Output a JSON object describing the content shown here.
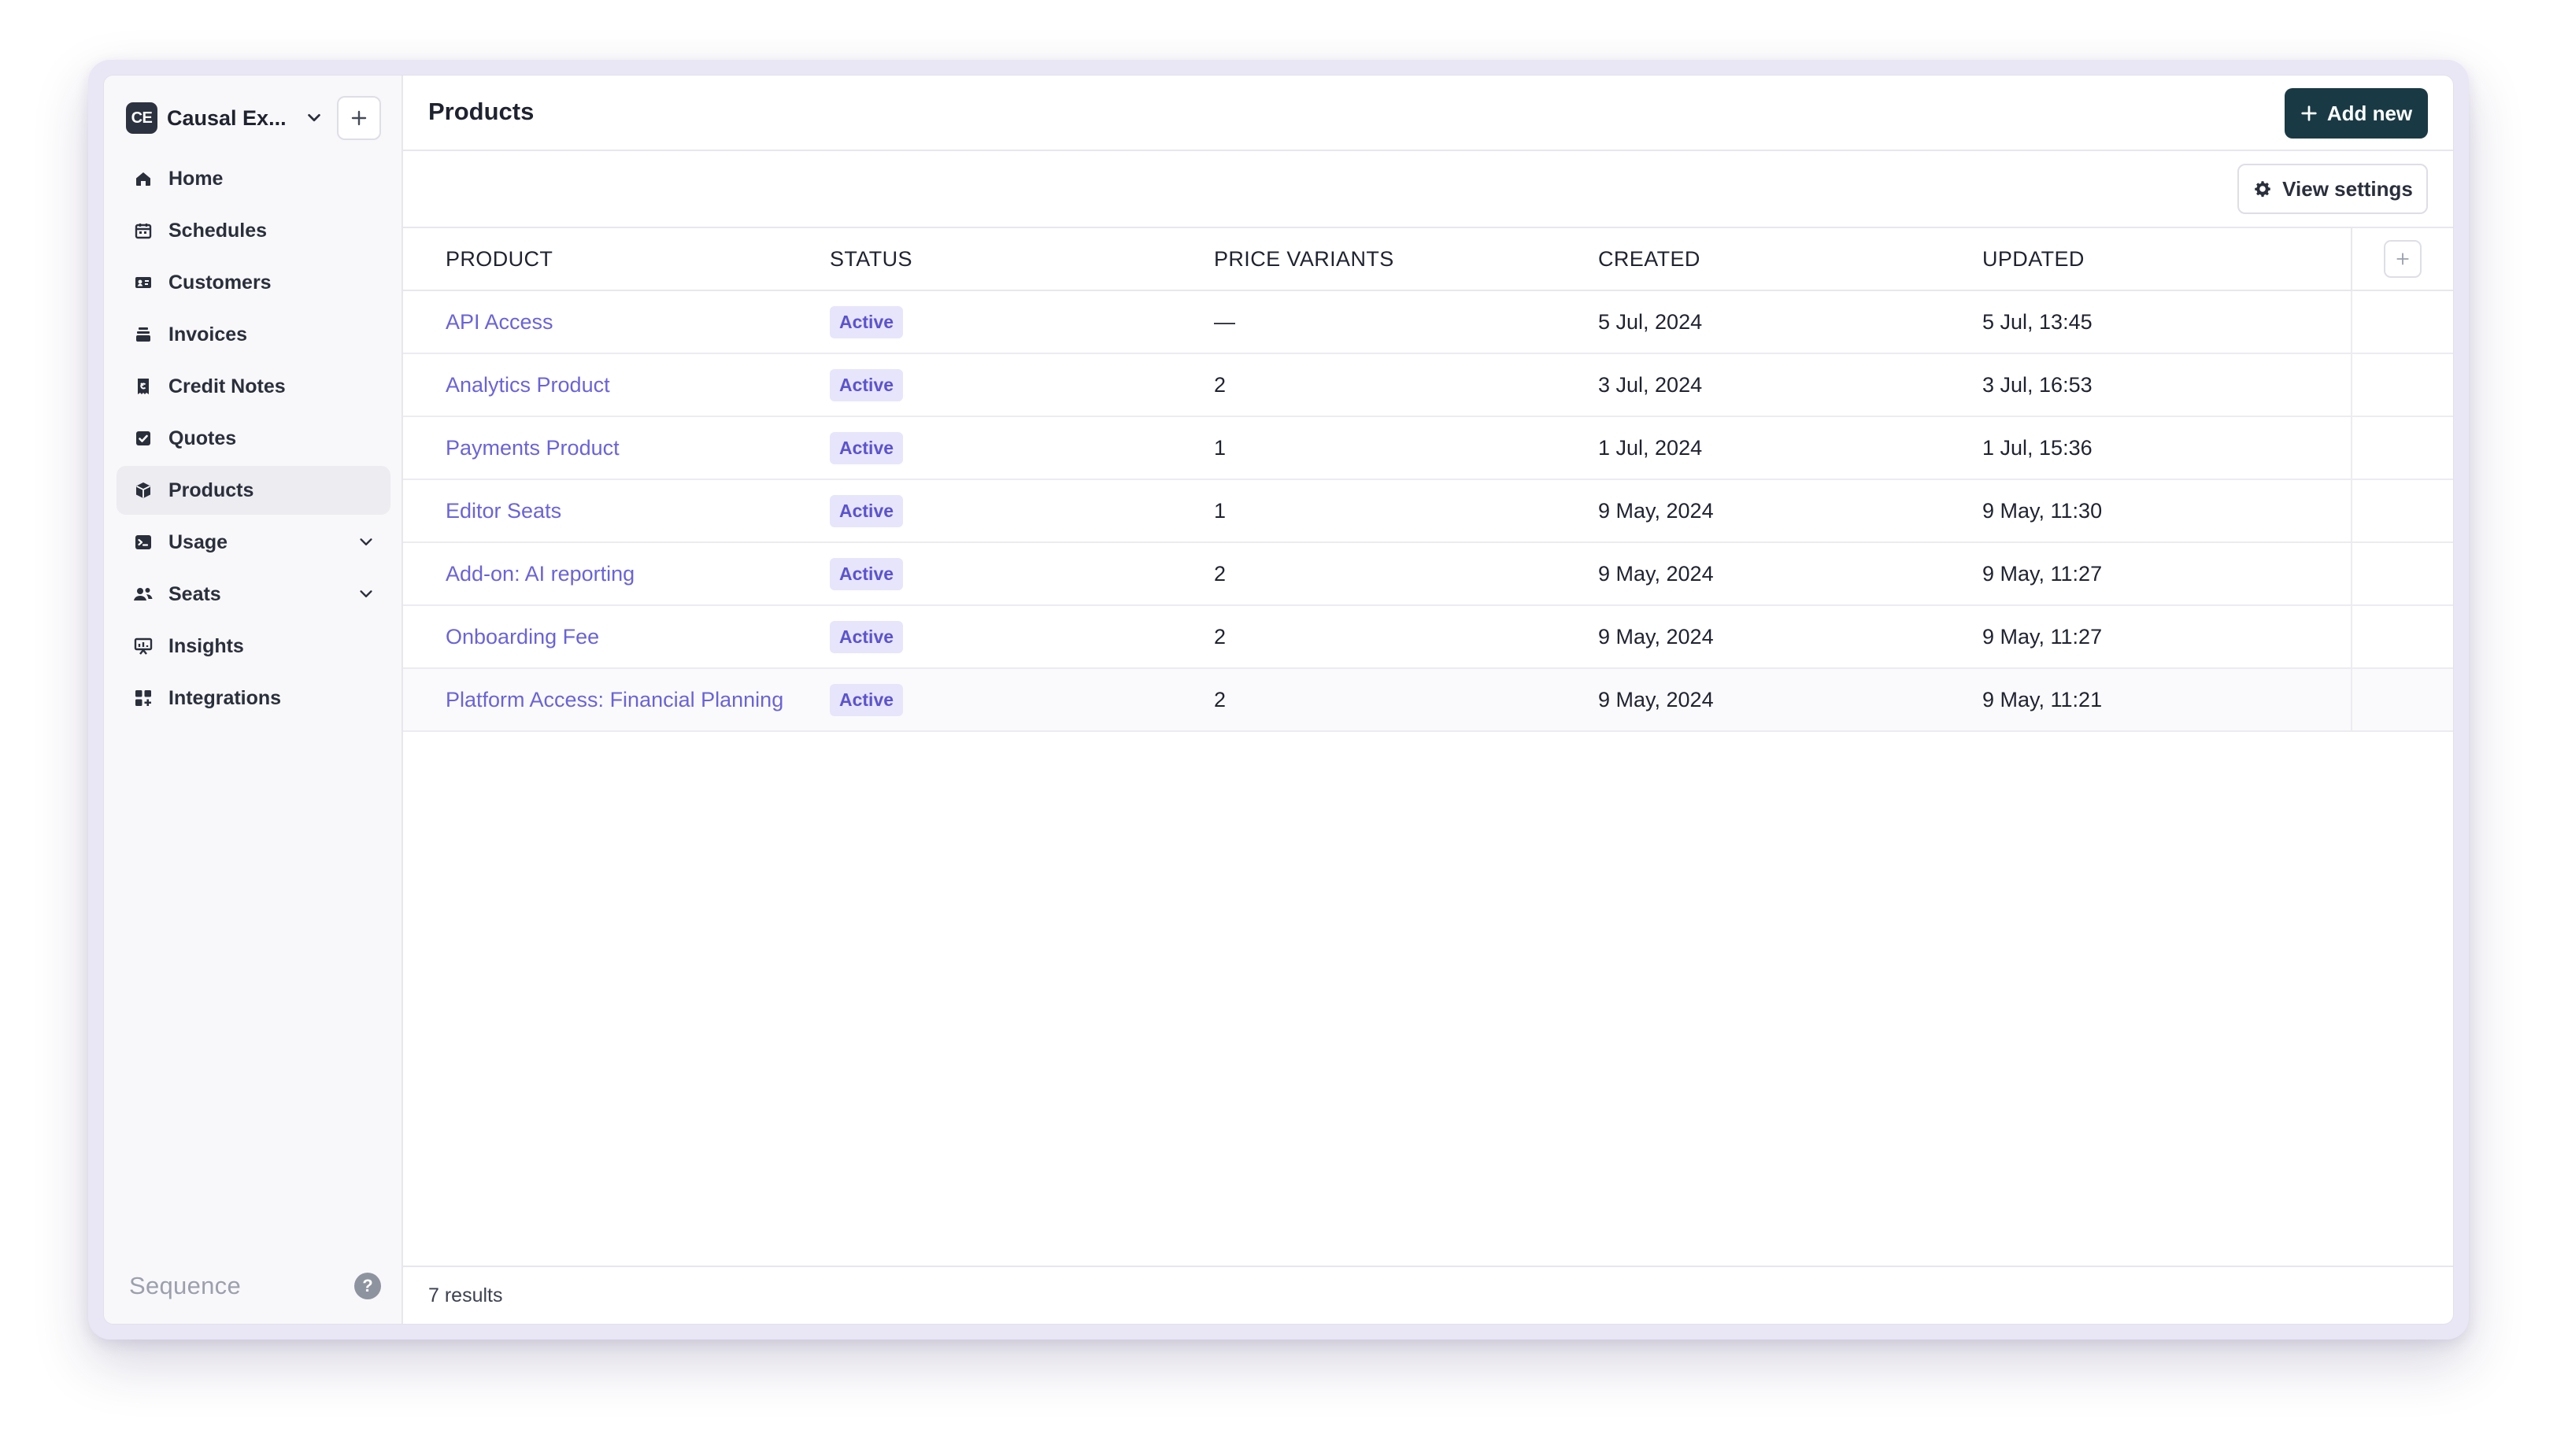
{
  "workspace": {
    "initials": "CE",
    "name": "Causal Ex..."
  },
  "sidebar": {
    "items": [
      {
        "label": "Home",
        "icon": "home-icon"
      },
      {
        "label": "Schedules",
        "icon": "calendar-icon"
      },
      {
        "label": "Customers",
        "icon": "id-card-icon"
      },
      {
        "label": "Invoices",
        "icon": "invoice-stack-icon"
      },
      {
        "label": "Credit Notes",
        "icon": "credit-note-icon"
      },
      {
        "label": "Quotes",
        "icon": "quote-check-icon"
      },
      {
        "label": "Products",
        "icon": "cube-icon",
        "active": true
      },
      {
        "label": "Usage",
        "icon": "terminal-icon",
        "expandable": true
      },
      {
        "label": "Seats",
        "icon": "users-icon",
        "expandable": true
      },
      {
        "label": "Insights",
        "icon": "chart-board-icon"
      },
      {
        "label": "Integrations",
        "icon": "grid-apps-icon"
      }
    ],
    "brand": "Sequence",
    "help": "?"
  },
  "header": {
    "title": "Products",
    "add_new": "Add new"
  },
  "toolbar": {
    "view_settings": "View settings"
  },
  "table": {
    "columns": [
      "PRODUCT",
      "STATUS",
      "PRICE VARIANTS",
      "CREATED",
      "UPDATED"
    ],
    "rows": [
      {
        "product": "API Access",
        "status": "Active",
        "variants": "—",
        "created": "5 Jul, 2024",
        "updated": "5 Jul, 13:45"
      },
      {
        "product": "Analytics Product",
        "status": "Active",
        "variants": "2",
        "created": "3 Jul, 2024",
        "updated": "3 Jul, 16:53"
      },
      {
        "product": "Payments Product",
        "status": "Active",
        "variants": "1",
        "created": "1 Jul, 2024",
        "updated": "1 Jul, 15:36"
      },
      {
        "product": "Editor Seats",
        "status": "Active",
        "variants": "1",
        "created": "9 May, 2024",
        "updated": "9 May, 11:30"
      },
      {
        "product": "Add-on: AI reporting",
        "status": "Active",
        "variants": "2",
        "created": "9 May, 2024",
        "updated": "9 May, 11:27"
      },
      {
        "product": "Onboarding Fee",
        "status": "Active",
        "variants": "2",
        "created": "9 May, 2024",
        "updated": "9 May, 11:27"
      },
      {
        "product": "Platform Access: Financial Planning",
        "status": "Active",
        "variants": "2",
        "created": "9 May, 2024",
        "updated": "9 May, 11:21"
      }
    ]
  },
  "footer": {
    "results": "7 results"
  },
  "colors": {
    "accent": "#6a63d9",
    "primary_button": "#193a44",
    "badge_bg": "#e7e5fb"
  }
}
